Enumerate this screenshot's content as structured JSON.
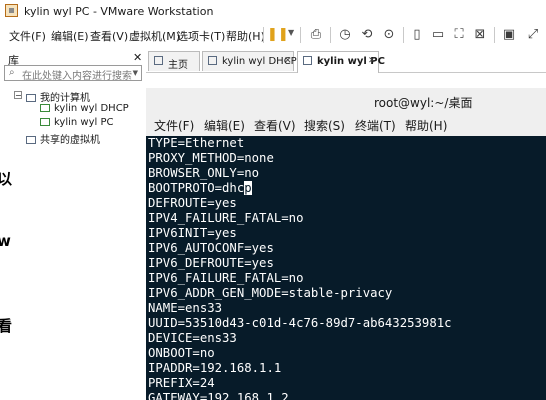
{
  "window": {
    "title": "kylin wyl PC - VMware Workstation"
  },
  "menu": [
    {
      "label": "文件(F)"
    },
    {
      "label": "编辑(E)"
    },
    {
      "label": "查看(V)"
    },
    {
      "label": "虚拟机(M)"
    },
    {
      "label": "选项卡(T)"
    },
    {
      "label": "帮助(H)"
    }
  ],
  "toolbar_icons": [
    "pause-icon",
    "send-ctrl-alt-del-icon",
    "snapshot-icon",
    "revert-snapshot-icon",
    "snapshot-manager-icon",
    "library-view-icon",
    "thumbnail-view-icon",
    "fullscreen-icon",
    "unity-icon",
    "console-icon",
    "stretch-icon"
  ],
  "library": {
    "title": "库",
    "close": "✕",
    "search_placeholder": "在此处键入内容进行搜索",
    "tree": {
      "root": "我的计算机",
      "vms": [
        "kylin wyl DHCP",
        "kylin wyl PC"
      ],
      "shared": "共享的虚拟机"
    }
  },
  "edge_glyphs": [
    "以",
    "w",
    "看"
  ],
  "tabs": [
    {
      "label": "主页"
    },
    {
      "label": "kylin wyl DHCP"
    },
    {
      "label": "kylin wyl PC"
    }
  ],
  "terminal": {
    "title": "root@wyl:~/桌面",
    "menu": [
      "文件(F)",
      "编辑(E)",
      "查看(V)",
      "搜索(S)",
      "终端(T)",
      "帮助(H)"
    ],
    "lines": [
      "TYPE=Ethernet",
      "PROXY_METHOD=none",
      "BROWSER_ONLY=no",
      "DEFROUTE=yes",
      "IPV4_FAILURE_FATAL=no",
      "IPV6INIT=yes",
      "IPV6_AUTOCONF=yes",
      "IPV6_DEFROUTE=yes",
      "IPV6_FAILURE_FATAL=no",
      "IPV6_ADDR_GEN_MODE=stable-privacy",
      "NAME=ens33",
      "UUID=53510d43-c01d-4c76-89d7-ab643253981c",
      "DEVICE=ens33",
      "ONBOOT=no",
      "IPADDR=192.168.1.1",
      "PREFIX=24",
      "GATEWAY=192.168.1.2"
    ],
    "bootproto_line": {
      "before": "BOOTPROTO=dhc",
      "cursor_char": "p"
    }
  }
}
